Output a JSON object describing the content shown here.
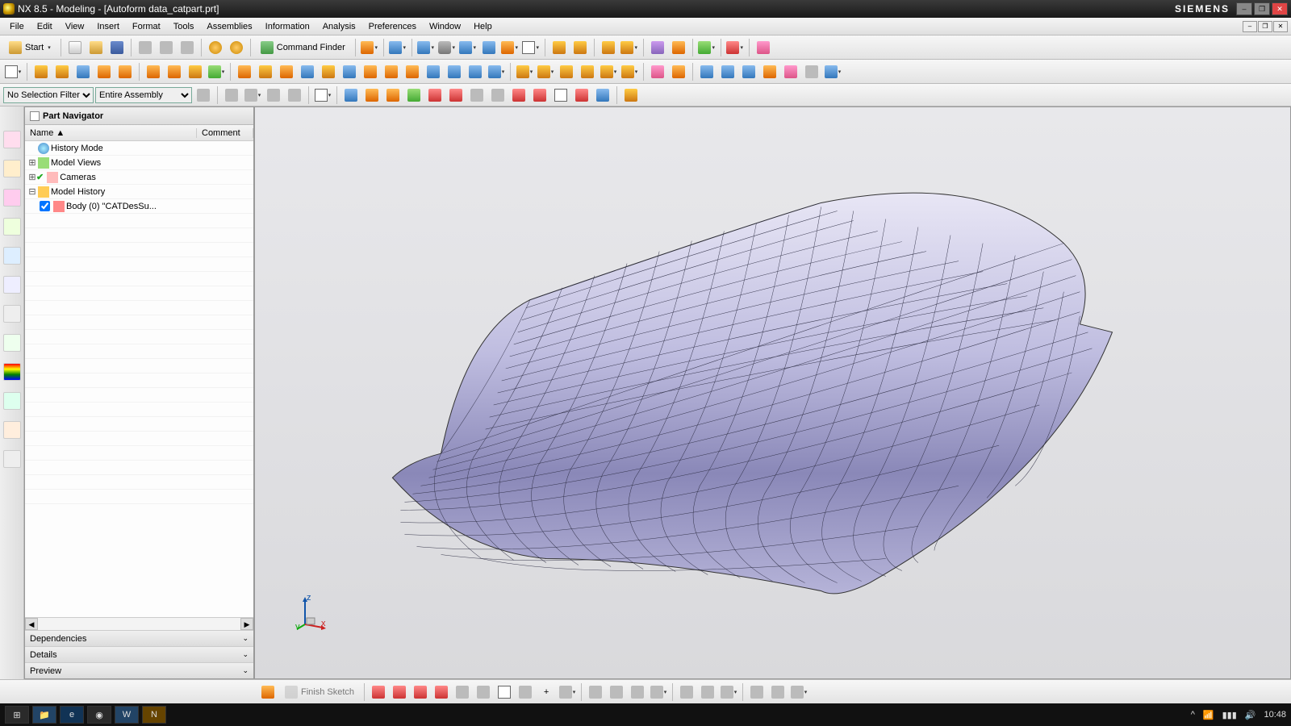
{
  "title": "NX 8.5 - Modeling - [Autoform data_catpart.prt]",
  "brand": "SIEMENS",
  "menu": [
    "File",
    "Edit",
    "View",
    "Insert",
    "Format",
    "Tools",
    "Assemblies",
    "Information",
    "Analysis",
    "Preferences",
    "Window",
    "Help"
  ],
  "start_label": "Start",
  "command_finder_label": "Command Finder",
  "finish_sketch_label": "Finish Sketch",
  "selection_filter": "No Selection Filter",
  "assembly_scope": "Entire Assembly",
  "part_navigator": {
    "title": "Part Navigator",
    "col_name": "Name",
    "col_comment": "Comment",
    "items": {
      "history_mode": "History Mode",
      "model_views": "Model Views",
      "cameras": "Cameras",
      "model_history": "Model History",
      "body": "Body (0) \"CATDesSu..."
    },
    "folds": [
      "Dependencies",
      "Details",
      "Preview"
    ]
  },
  "triad": {
    "x": "x",
    "y": "y",
    "z": "z"
  },
  "clock": "10:48"
}
